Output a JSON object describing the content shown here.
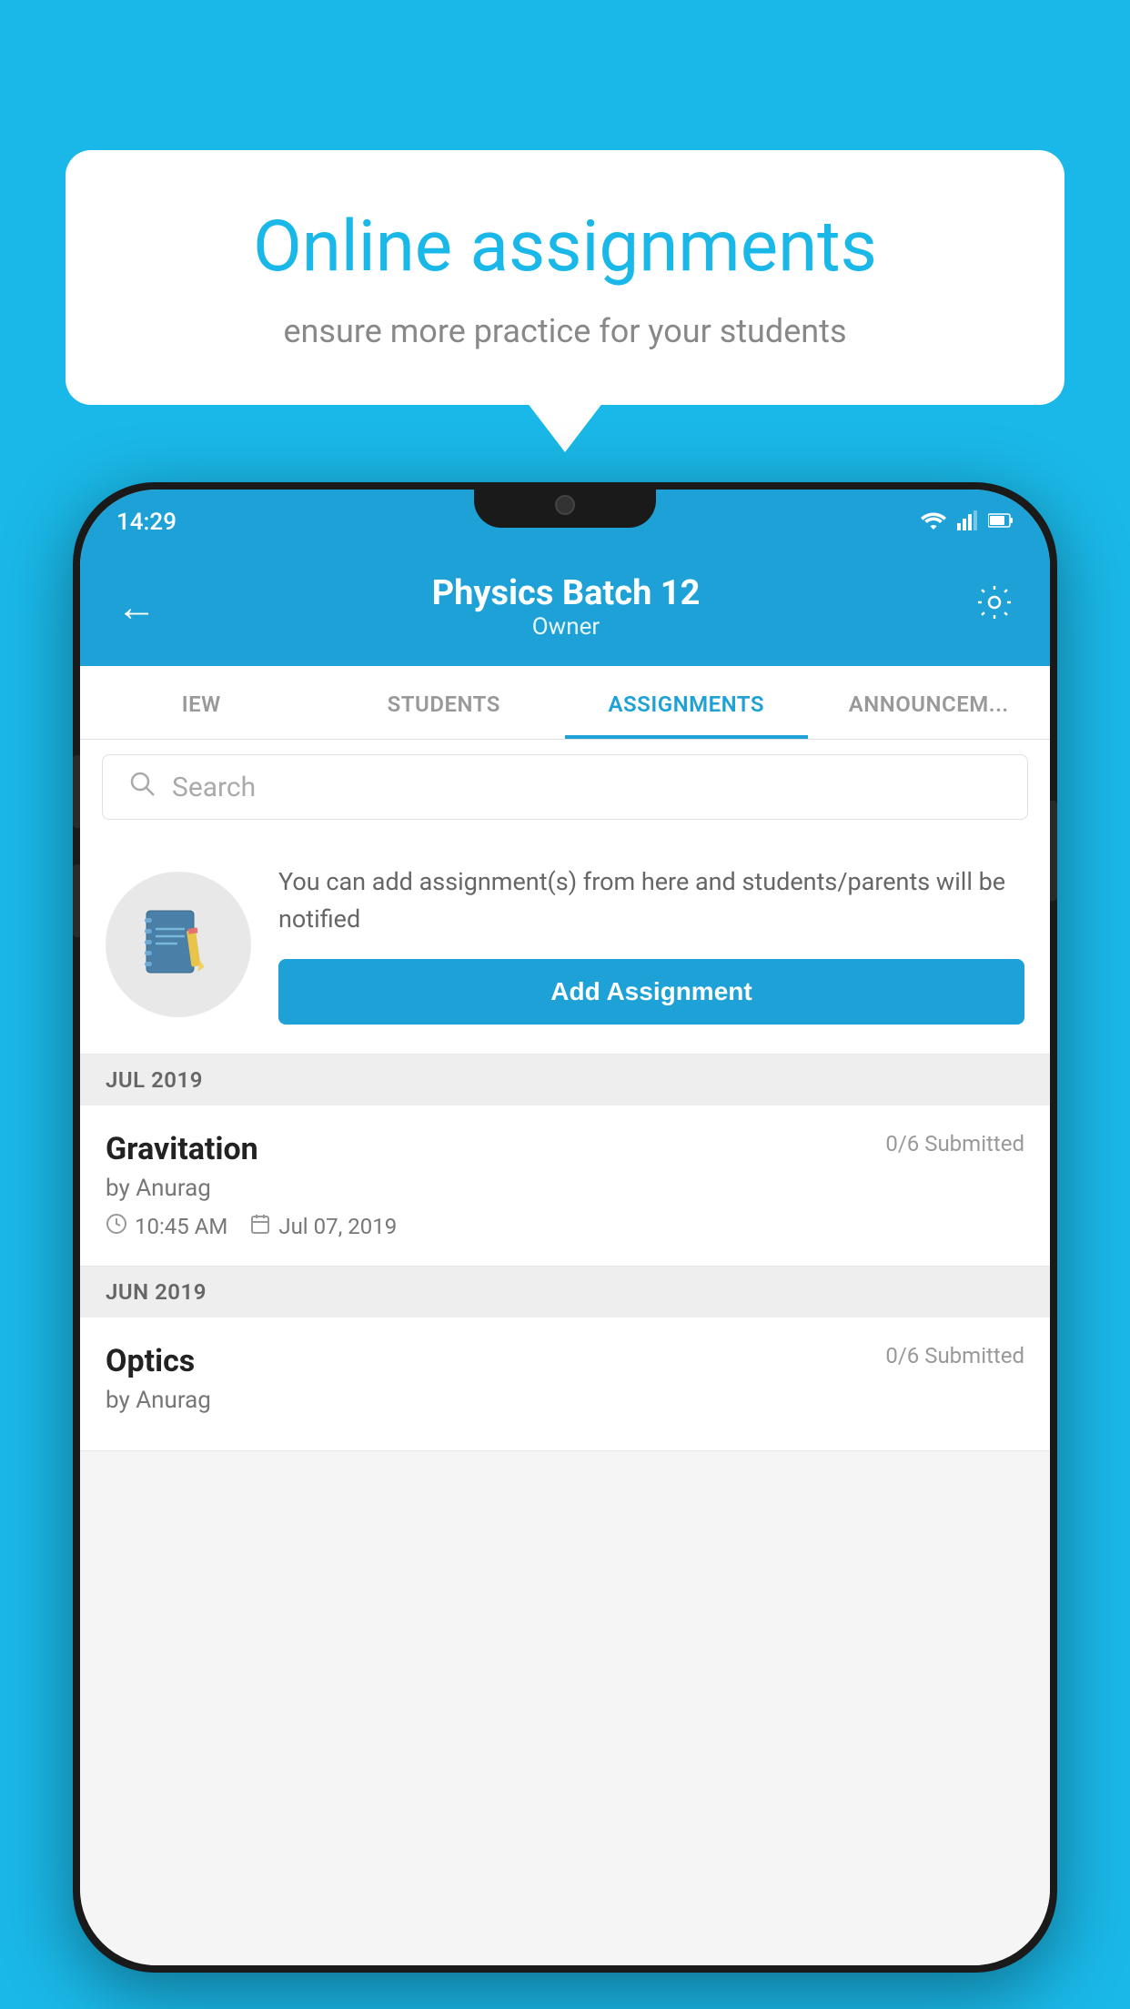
{
  "background": {
    "color": "#1ab8e8"
  },
  "speech_bubble": {
    "title": "Online assignments",
    "subtitle": "ensure more practice for your students"
  },
  "status_bar": {
    "time": "14:29",
    "wifi": "▼",
    "signal": "▲",
    "battery": "▐"
  },
  "header": {
    "title": "Physics Batch 12",
    "subtitle": "Owner",
    "back_label": "←",
    "settings_label": "⚙"
  },
  "tabs": [
    {
      "label": "IEW",
      "active": false
    },
    {
      "label": "STUDENTS",
      "active": false
    },
    {
      "label": "ASSIGNMENTS",
      "active": true
    },
    {
      "label": "ANNOUNCEM...",
      "active": false
    }
  ],
  "search": {
    "placeholder": "Search"
  },
  "info_card": {
    "description": "You can add assignment(s) from here and students/parents will be notified",
    "button_label": "Add Assignment"
  },
  "sections": [
    {
      "month": "JUL 2019",
      "assignments": [
        {
          "title": "Gravitation",
          "submitted": "0/6 Submitted",
          "author": "by Anurag",
          "time": "10:45 AM",
          "date": "Jul 07, 2019"
        }
      ]
    },
    {
      "month": "JUN 2019",
      "assignments": [
        {
          "title": "Optics",
          "submitted": "0/6 Submitted",
          "author": "by Anurag",
          "time": "",
          "date": ""
        }
      ]
    }
  ]
}
